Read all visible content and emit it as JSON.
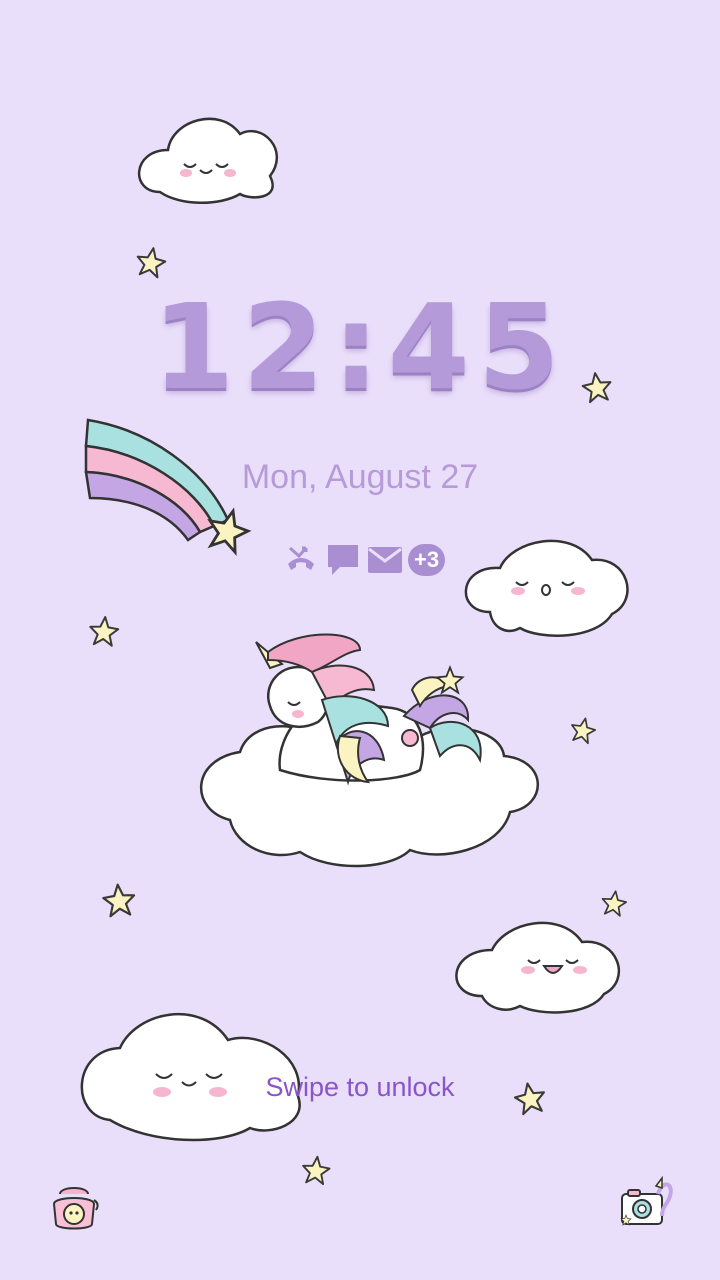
{
  "lockscreen": {
    "clock": "12:45",
    "date": "Mon, August 27",
    "notification_icons": [
      "missed-call-icon",
      "message-icon",
      "email-icon"
    ],
    "notification_more": "+3",
    "swipe_hint": "Swipe to unlock",
    "shortcut_left": "phone-icon",
    "shortcut_right": "camera-icon"
  },
  "colors": {
    "background": "#eadffb",
    "clock": "#b49ad8",
    "date": "#b79bd9",
    "swipe_hint": "#8a55c8"
  }
}
